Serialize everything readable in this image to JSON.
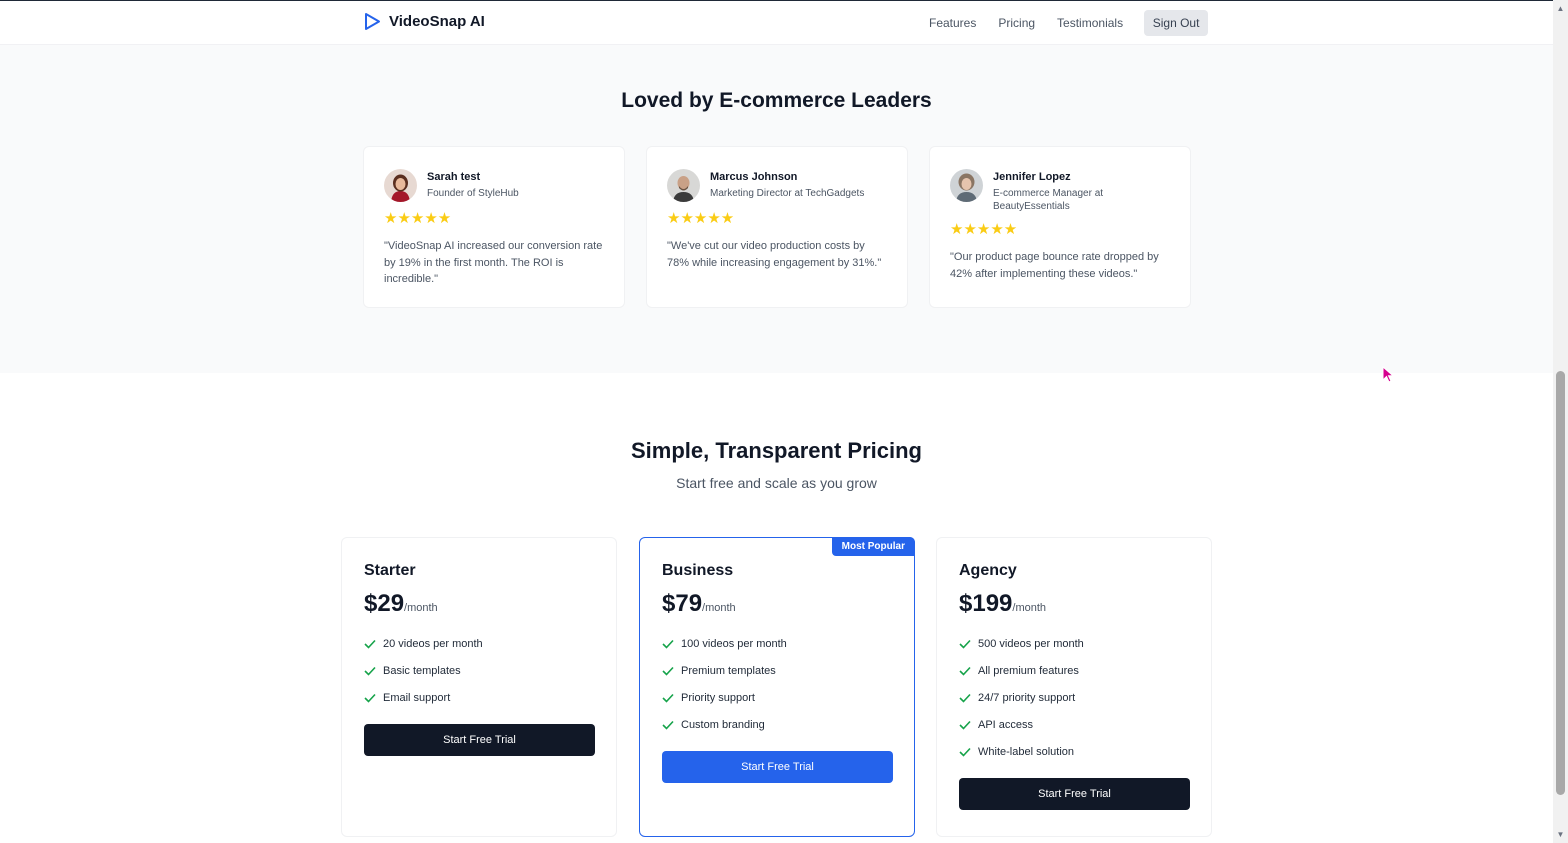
{
  "header": {
    "logo_text": "VideoSnap AI",
    "nav": [
      "Features",
      "Pricing",
      "Testimonials"
    ],
    "sign_out_label": "Sign Out"
  },
  "testimonials": {
    "title": "Loved by E-commerce Leaders",
    "items": [
      {
        "name": "Sarah test",
        "role": "Founder of StyleHub",
        "stars": "★★★★★",
        "quote": "\"VideoSnap AI increased our conversion rate by 19% in the first month. The ROI is incredible.\""
      },
      {
        "name": "Marcus Johnson",
        "role": "Marketing Director at TechGadgets",
        "stars": "★★★★★",
        "quote": "\"We've cut our video production costs by 78% while increasing engagement by 31%.\""
      },
      {
        "name": "Jennifer Lopez",
        "role": "E-commerce Manager at BeautyEssentials",
        "stars": "★★★★★",
        "quote": "\"Our product page bounce rate dropped by 42% after implementing these videos.\""
      }
    ]
  },
  "pricing": {
    "title": "Simple, Transparent Pricing",
    "subtitle": "Start free and scale as you grow",
    "plans": [
      {
        "name": "Starter",
        "price": "$29",
        "period": "/month",
        "features": [
          "20 videos per month",
          "Basic templates",
          "Email support"
        ],
        "cta": "Start Free Trial"
      },
      {
        "name": "Business",
        "badge": "Most Popular",
        "price": "$79",
        "period": "/month",
        "features": [
          "100 videos per month",
          "Premium templates",
          "Priority support",
          "Custom branding"
        ],
        "cta": "Start Free Trial"
      },
      {
        "name": "Agency",
        "price": "$199",
        "period": "/month",
        "features": [
          "500 videos per month",
          "All premium features",
          "24/7 priority support",
          "API access",
          "White-label solution"
        ],
        "cta": "Start Free Trial"
      }
    ]
  },
  "colors": {
    "accent": "#2563eb",
    "dark_button": "#111827",
    "star": "#facc15",
    "check": "#16a34a"
  }
}
